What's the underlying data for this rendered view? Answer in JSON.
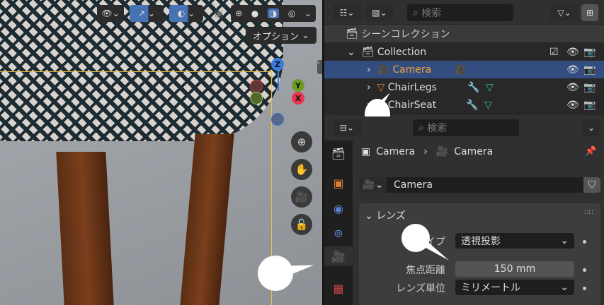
{
  "viewport": {
    "options_label": "オプション",
    "gizmo": {
      "z": "Z",
      "y": "Y",
      "x": "X"
    }
  },
  "outliner": {
    "search_placeholder": "検索",
    "scene_collection": "シーンコレクション",
    "collection": "Collection",
    "items": [
      {
        "name": "Camera",
        "selected": true
      },
      {
        "name": "ChairLegs"
      },
      {
        "name": "ChairSeat"
      }
    ]
  },
  "properties": {
    "search_placeholder": "検索",
    "breadcrumb": [
      "Camera",
      "Camera"
    ],
    "datablock_name": "Camera",
    "panel_title": "レンズ",
    "fields": {
      "type_label": "タイプ",
      "type_value": "透視投影",
      "focal_label": "焦点距離",
      "focal_value": "150 mm",
      "unit_label": "レンズ単位",
      "unit_value": "ミリメートル"
    }
  },
  "colors": {
    "accent": "#4772b3",
    "selected_row": "#334d80",
    "camera_orange": "#e8a23a",
    "data_green": "#2fb89a"
  }
}
